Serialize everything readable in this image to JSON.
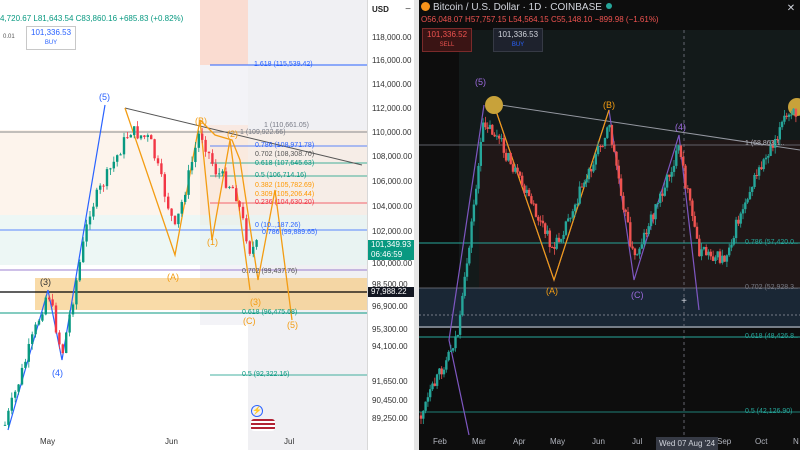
{
  "left_chart": {
    "ohlc": {
      "o": "4,720.67",
      "l": "L81,643.54",
      "c": "C83,860.16",
      "chg": "+685.83 (+0.82%)"
    },
    "indicator_value": "0.01",
    "buy_price": "101,336.53",
    "buy_label": "BUY",
    "price_axis": {
      "currency": "USD",
      "labels": [
        "118,000.00",
        "116,000.00",
        "114,000.00",
        "112,000.00",
        "110,000.00",
        "108,000.00",
        "106,000.00",
        "104,000.00",
        "102,000.00",
        "100,000.00",
        "98,500.00",
        "96,900.00",
        "95,300.00",
        "94,100.00",
        "91,650.00",
        "90,450.00",
        "89,250.00"
      ],
      "current_price": "101,349.93",
      "countdown": "06:46:59",
      "crosshair_price": "97,988.22"
    },
    "x_labels": [
      "May",
      "Jun",
      "Jul"
    ],
    "fib_levels": [
      {
        "text": "1.618 (115,539.42)",
        "color": "#2962ff"
      },
      {
        "text": "1 (110,661.05)",
        "color": "#787b86"
      },
      {
        "text": "1 (109,922.66)",
        "color": "#787b86"
      },
      {
        "text": "0.786 (108,971.78)",
        "color": "#2962ff"
      },
      {
        "text": "0.702 (108,308.70)",
        "color": "#555555"
      },
      {
        "text": "0.618 (107,645.63)",
        "color": "#089981"
      },
      {
        "text": "0.5 (106,714.16)",
        "color": "#089981"
      },
      {
        "text": "0.382 (105,782.69)",
        "color": "#ff9800"
      },
      {
        "text": "0.309 (105,206.44)",
        "color": "#ff9800"
      },
      {
        "text": "0.236 (104,630.20)",
        "color": "#f23645"
      },
      {
        "text": "0 (10..,187.26)",
        "color": "#2962ff"
      },
      {
        "text": "0.786 (99,889.65)",
        "color": "#2962ff"
      },
      {
        "text": "0.702 (99,437.76)",
        "color": "#555555"
      },
      {
        "text": "0.618 (96,475.68)",
        "color": "#089981"
      },
      {
        "text": "0.5 (92,322.16)",
        "color": "#089981"
      }
    ],
    "waves": [
      "(5)",
      "(3)",
      "(4)",
      "(B)",
      "(2)",
      "(A)",
      "(1)",
      "(3)",
      "(C)",
      "(5)"
    ]
  },
  "right_chart": {
    "title": "Bitcoin / U.S. Dollar · 1D · COINBASE",
    "ohlc": {
      "o": "O56,048.07",
      "h": "H57,757.15",
      "l": "L54,564.15",
      "c": "C55,148.10",
      "chg": "−899.98 (−1.61%)"
    },
    "sell_price": "101,336.52",
    "sell_label": "SELL",
    "buy_price": "101,336.53",
    "buy_label": "BUY",
    "x_labels": [
      "Feb",
      "Mar",
      "Apr",
      "May",
      "Jun",
      "Jul",
      "Sep",
      "Oct",
      "N"
    ],
    "crosshair_date": "Wed 07 Aug '24",
    "fib_levels": [
      {
        "text": "1 (68,863.1..",
        "color": "#b2b5be"
      },
      {
        "text": "0.786 (57,420.0..",
        "color": "#26a69a"
      },
      {
        "text": "0.702 (52,928.3..",
        "color": "#787b86"
      },
      {
        "text": "0.618 (48,426.8..",
        "color": "#26a69a"
      },
      {
        "text": "0.5 (42,126.90)",
        "color": "#26a69a"
      }
    ],
    "waves": [
      "(5)",
      "(B)",
      "(A)",
      "(C)",
      "(4)"
    ]
  },
  "icons": [
    "minus-icon",
    "close-icon",
    "lightning-icon",
    "us-flag-icon",
    "crosshair-icon"
  ]
}
